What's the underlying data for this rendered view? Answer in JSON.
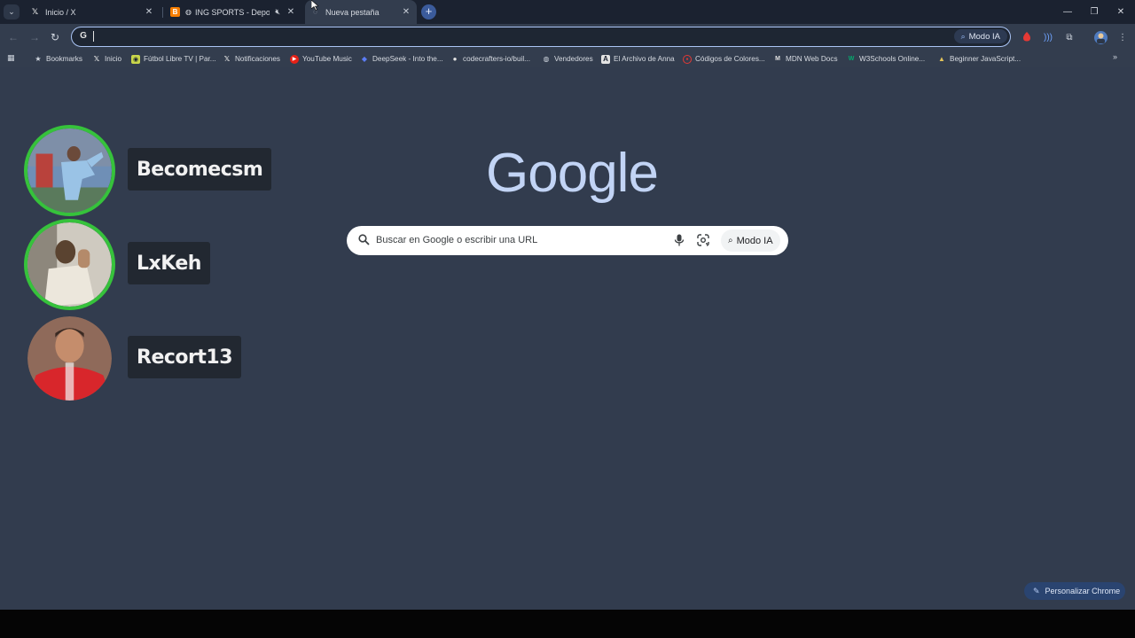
{
  "tabs": [
    {
      "title": "Inicio / X",
      "favicon": "x-logo"
    },
    {
      "title": "ING SPORTS - Deportes",
      "favicon": "blogger-logo"
    },
    {
      "title": "Nueva pestaña",
      "favicon": "new-tab",
      "active": true
    }
  ],
  "toolbar": {
    "omnibox_value": "",
    "ai_mode_label": "Modo IA"
  },
  "bookmarks": [
    {
      "label": "Bookmarks",
      "icon": "star-icon"
    },
    {
      "label": "Inicio",
      "icon": "x-logo"
    },
    {
      "label": "Fútbol Libre TV | Par...",
      "icon": "futbol-icon"
    },
    {
      "label": "Notificaciones",
      "icon": "x-logo"
    },
    {
      "label": "YouTube Music",
      "icon": "youtube-music-icon"
    },
    {
      "label": "DeepSeek - Into the...",
      "icon": "deepseek-icon"
    },
    {
      "label": "codecrafters-io/buil...",
      "icon": "github-icon"
    },
    {
      "label": "Vendedores",
      "icon": "globe-icon"
    },
    {
      "label": "El Archivo de Anna",
      "icon": "anna-icon"
    },
    {
      "label": "Códigos de Colores...",
      "icon": "color-icon"
    },
    {
      "label": "MDN Web Docs",
      "icon": "mdn-icon"
    },
    {
      "label": "W3Schools Online...",
      "icon": "w3schools-icon"
    },
    {
      "label": "Beginner JavaScript...",
      "icon": "js-icon"
    }
  ],
  "google": {
    "logo": "Google",
    "search_placeholder": "Buscar en Google o escribir una URL",
    "ai_mode_label": "Modo IA"
  },
  "streamers": [
    {
      "name": "Becomecsm",
      "live": true
    },
    {
      "name": "LxKeh",
      "live": true
    },
    {
      "name": "Recort13",
      "live": false
    }
  ],
  "customize_label": "Personalizar Chrome",
  "colors": {
    "background": "#323c4e",
    "live_ring": "#36c23b",
    "omnibox_focus": "#aac4f5",
    "google_logo": "#c2d4f5"
  }
}
